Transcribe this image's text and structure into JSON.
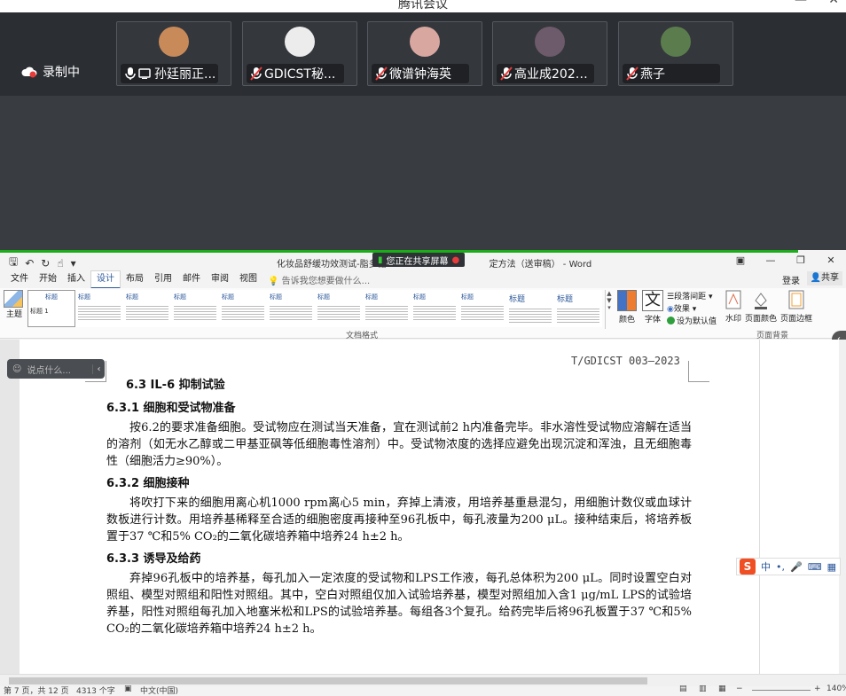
{
  "meeting": {
    "title": "腾讯会议",
    "recording_label": "录制中",
    "participants": [
      {
        "name": "孙廷丽正...",
        "muted": false,
        "color": "#c98a5a"
      },
      {
        "name": "GDICST秘...",
        "muted": true,
        "color": "#e9e9e9"
      },
      {
        "name": "微谱钟海英",
        "muted": true,
        "color": "#d8a7a0"
      },
      {
        "name": "高业成2022...",
        "muted": true,
        "color": "#6d5a6a"
      },
      {
        "name": "燕子",
        "muted": true,
        "color": "#5b7d4e"
      }
    ],
    "chat_placeholder": "说点什么..."
  },
  "word": {
    "doc_title": "化妆品舒缓功效测试-脂多糖",
    "doc_title_suffix": "定方法（送审稿） - Word",
    "sharing_badge": "您正在共享屏幕",
    "tabs": [
      "文件",
      "开始",
      "插入",
      "设计",
      "布局",
      "引用",
      "邮件",
      "审阅",
      "视图"
    ],
    "active_tab": "设计",
    "tell_me": "告诉我您想要做什么...",
    "login": "登录",
    "share": "共享",
    "ribbon": {
      "theme_label": "主题",
      "style_first_title": "标题",
      "style_first_sub": "标题 1",
      "style_titles": [
        "标题",
        "标题",
        "标题",
        "标题",
        "标题",
        "标题",
        "标题",
        "标题",
        "标题",
        "标题",
        "标题"
      ],
      "document_format_label": "文档格式",
      "colors_label": "颜色",
      "fonts_label": "字体",
      "fonts_glyph": "文",
      "paragraph_spacing": "段落间距",
      "effects": "效果",
      "set_default": "设为默认值",
      "watermark": "水印",
      "page_color": "页面颜色",
      "page_borders": "页面边框",
      "page_background_label": "页面背景"
    },
    "document": {
      "header": "T/GDICST 003—2023",
      "h2": "6.3   IL-6 抑制试验",
      "sections": [
        {
          "title": "6.3.1   细胞和受试物准备",
          "body": "按6.2的要求准备细胞。受试物应在测试当天准备，宜在测试前2 h内准备完毕。非水溶性受试物应溶解在适当的溶剂（如无水乙醇或二甲基亚砜等低细胞毒性溶剂）中。受试物浓度的选择应避免出现沉淀和浑浊，且无细胞毒性（细胞活力≥90%）。"
        },
        {
          "title": "6.3.2   细胞接种",
          "body": "将吹打下来的细胞用离心机1000 rpm离心5 min，弃掉上清液，用培养基重悬混匀，用细胞计数仪或血球计数板进行计数。用培养基稀释至合适的细胞密度再接种至96孔板中，每孔液量为200 μL。接种结束后，将培养板置于37 ℃和5% CO₂的二氧化碳培养箱中培养24 h±2 h。"
        },
        {
          "title": "6.3.3   诱导及给药",
          "body": "弃掉96孔板中的培养基，每孔加入一定浓度的受试物和LPS工作液，每孔总体积为200 μL。同时设置空白对照组、模型对照组和阳性对照组。其中，空白对照组仅加入试验培养基，模型对照组加入含1 μg/mL LPS的试验培养基，阳性对照组每孔加入地塞米松和LPS的试验培养基。每组各3个复孔。给药完毕后将96孔板置于37 ℃和5% CO₂的二氧化碳培养箱中培养24 h±2 h。"
        }
      ]
    },
    "ime": {
      "logo": "S",
      "mode": "中"
    },
    "status": {
      "page": "第 7 页，共 12 页",
      "words": "4313 个字",
      "lang": "中文(中国)",
      "zoom": "140%"
    }
  }
}
